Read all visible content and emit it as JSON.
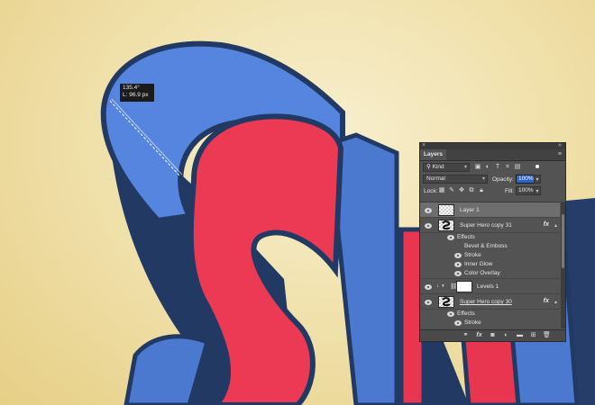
{
  "measurement": {
    "angle": "135.4°",
    "length": "L: 96.9 px"
  },
  "panel": {
    "tab": "Layers",
    "close_glyph": "×",
    "collapse_glyph": "»",
    "menu_glyph": "≡",
    "filter_kind": "Kind",
    "blend_mode": "Normal",
    "opacity_label": "Opacity:",
    "opacity_value": "100%",
    "lock_label": "Lock:",
    "fill_label": "Fill:",
    "fill_value": "100%",
    "fx_glyph": "fx",
    "layers": [
      {
        "name": "Layer 1"
      },
      {
        "name": "Super Hero copy 31"
      },
      {
        "name": "Effects"
      },
      {
        "name": "Bevel & Emboss"
      },
      {
        "name": "Stroke"
      },
      {
        "name": "Inner Glow"
      },
      {
        "name": "Color Overlay"
      },
      {
        "name": "Levels 1"
      },
      {
        "name": "Super Hero copy 30"
      },
      {
        "name": "Effects"
      },
      {
        "name": "Stroke"
      }
    ]
  },
  "colors": {
    "accent": "#2d62c8",
    "letter_red": "#ec3a54",
    "letter_blue": "#4f80d8",
    "outline": "#213760",
    "panel_bg": "#535353"
  }
}
